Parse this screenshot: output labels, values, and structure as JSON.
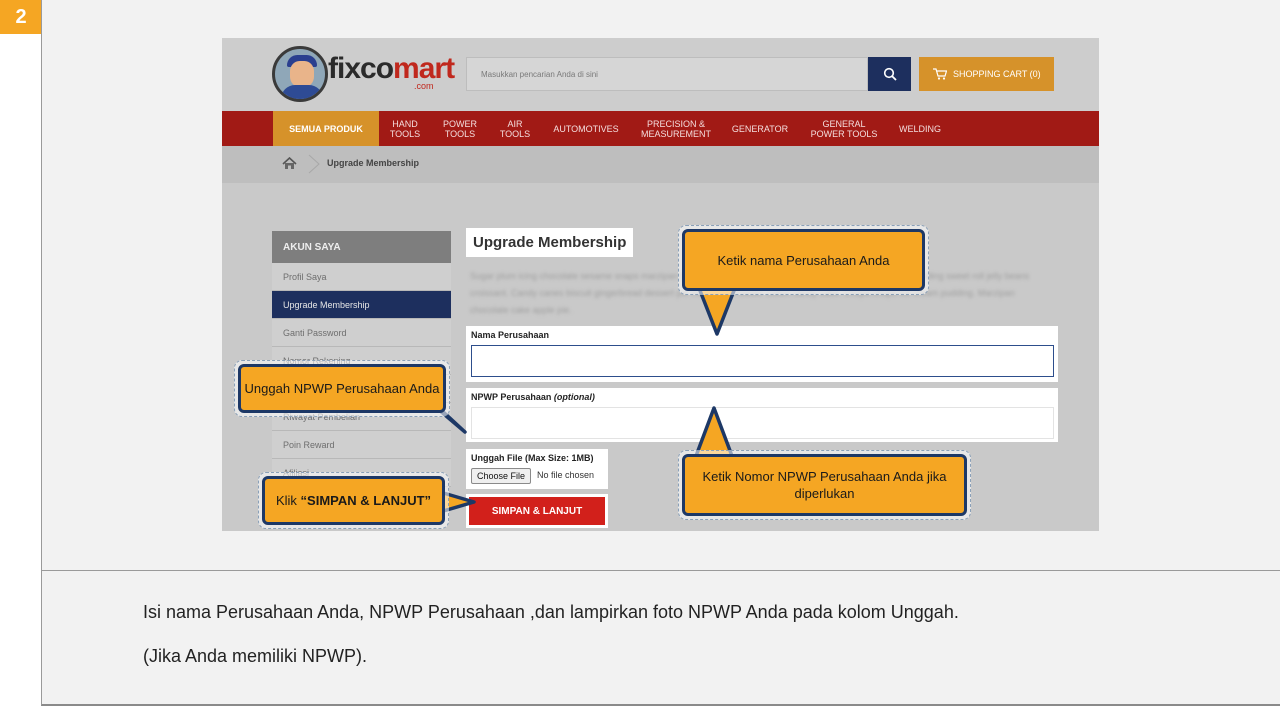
{
  "step": "2",
  "caption": {
    "line1": "Isi nama Perusahaan Anda, NPWP Perusahaan ,dan lampirkan foto NPWP Anda pada kolom Unggah.",
    "line2": "(Jika Anda memiliki NPWP)."
  },
  "site": {
    "logo_main": "fixco",
    "logo_accent": "mart",
    "logo_sub": ".com",
    "search_placeholder": "Masukkan pencarian Anda di sini",
    "cart_label": "SHOPPING CART (0)"
  },
  "nav": [
    {
      "label": "SEMUA PRODUK"
    },
    {
      "label": "HAND\nTOOLS"
    },
    {
      "label": "POWER\nTOOLS"
    },
    {
      "label": "AIR\nTOOLS"
    },
    {
      "label": "AUTOMOTIVES"
    },
    {
      "label": "PRECISION &\nMEASUREMENT"
    },
    {
      "label": "GENERATOR"
    },
    {
      "label": "GENERAL\nPOWER TOOLS"
    },
    {
      "label": "WELDING"
    }
  ],
  "breadcrumb": {
    "current": "Upgrade Membership"
  },
  "sidebar": {
    "title": "AKUN SAYA",
    "items": [
      "Profil Saya",
      "Upgrade Membership",
      "Ganti Password",
      "Nomor Rekening",
      "",
      "Riwayat Pembelian",
      "Poin Reward",
      "Afiliasi"
    ]
  },
  "main": {
    "title": "Upgrade Membership",
    "intro": "Sugar plum icing chocolate sesame snaps marzipan tart jelly beans tart marshmallow. Tootsie roll lemon drops pudding sweet roll jelly beans croissant. Candy canes biscuit gingerbread dessert pie marzipan. Powder cotton candy cake. Chupa chups ice cream pudding. Marzipan chocolate cake apple pie.",
    "nama_label": "Nama Perusahaan",
    "npwp_label": "NPWP Perusahaan",
    "npwp_optional": "(optional)",
    "upload_label": "Unggah File (Max Size: 1MB)",
    "choose_file": "Choose File",
    "no_file": "No file chosen",
    "save_label": "SIMPAN & LANJUT"
  },
  "callouts": {
    "nama": "Ketik nama Perusahaan Anda",
    "npwp_file": "Unggah NPWP Perusahaan Anda",
    "npwp_no": "Ketik Nomor NPWP Perusahaan Anda jika diperlukan",
    "save_prefix": "Klik ",
    "save_bold": "“SIMPAN & LANJUT”"
  },
  "colors": {
    "accent_orange": "#f5a623",
    "navy": "#1d3866",
    "nav_red": "#a11a15",
    "save_red": "#d2201b"
  }
}
